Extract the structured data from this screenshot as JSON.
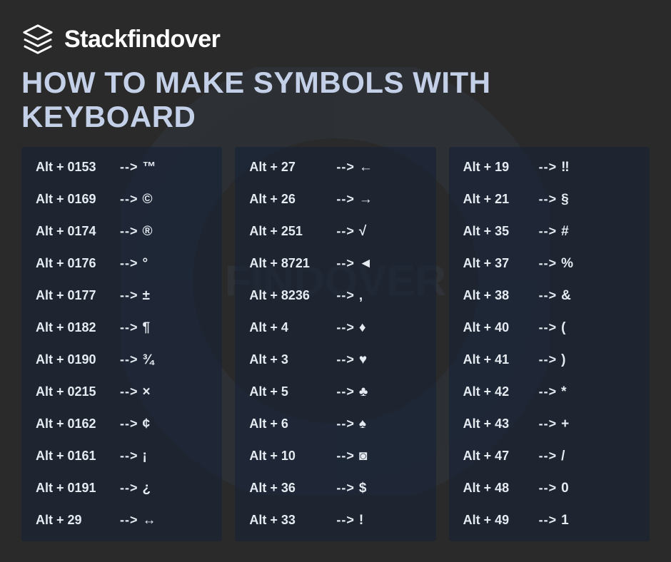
{
  "brand": {
    "name": "Stackfindover"
  },
  "title": "HOW TO MAKE SYMBOLS WITH KEYBOARD",
  "arrow": "-->",
  "columns": [
    [
      {
        "key": "Alt + 0153",
        "symbol": "™"
      },
      {
        "key": "Alt + 0169",
        "symbol": "©"
      },
      {
        "key": "Alt + 0174",
        "symbol": "®"
      },
      {
        "key": "Alt + 0176",
        "symbol": "°"
      },
      {
        "key": "Alt + 0177",
        "symbol": "±"
      },
      {
        "key": "Alt + 0182",
        "symbol": "¶"
      },
      {
        "key": "Alt + 0190",
        "symbol": "¾"
      },
      {
        "key": "Alt + 0215",
        "symbol": "×"
      },
      {
        "key": "Alt + 0162",
        "symbol": "¢"
      },
      {
        "key": "Alt + 0161",
        "symbol": "¡"
      },
      {
        "key": "Alt + 0191",
        "symbol": "¿"
      },
      {
        "key": "Alt + 29",
        "symbol": "↔"
      }
    ],
    [
      {
        "key": "Alt + 27",
        "symbol": "←"
      },
      {
        "key": "Alt + 26",
        "symbol": "→"
      },
      {
        "key": "Alt + 251",
        "symbol": "√"
      },
      {
        "key": "Alt + 8721",
        "symbol": "◄"
      },
      {
        "key": "Alt + 8236",
        "symbol": ","
      },
      {
        "key": "Alt + 4",
        "symbol": "♦"
      },
      {
        "key": "Alt + 3",
        "symbol": "♥"
      },
      {
        "key": "Alt + 5",
        "symbol": "♣"
      },
      {
        "key": "Alt + 6",
        "symbol": "♠"
      },
      {
        "key": "Alt + 10",
        "symbol": "◙"
      },
      {
        "key": "Alt + 36",
        "symbol": "$"
      },
      {
        "key": "Alt + 33",
        "symbol": "!"
      }
    ],
    [
      {
        "key": "Alt + 19",
        "symbol": "‼"
      },
      {
        "key": "Alt + 21",
        "symbol": "§"
      },
      {
        "key": "Alt + 35",
        "symbol": "#"
      },
      {
        "key": "Alt + 37",
        "symbol": "%"
      },
      {
        "key": "Alt + 38",
        "symbol": "&"
      },
      {
        "key": "Alt + 40",
        "symbol": "("
      },
      {
        "key": "Alt + 41",
        "symbol": ")"
      },
      {
        "key": "Alt + 42",
        "symbol": "*"
      },
      {
        "key": "Alt + 43",
        "symbol": "+"
      },
      {
        "key": "Alt + 47",
        "symbol": "/"
      },
      {
        "key": "Alt + 48",
        "symbol": "0"
      },
      {
        "key": "Alt + 49",
        "symbol": "1"
      }
    ]
  ]
}
